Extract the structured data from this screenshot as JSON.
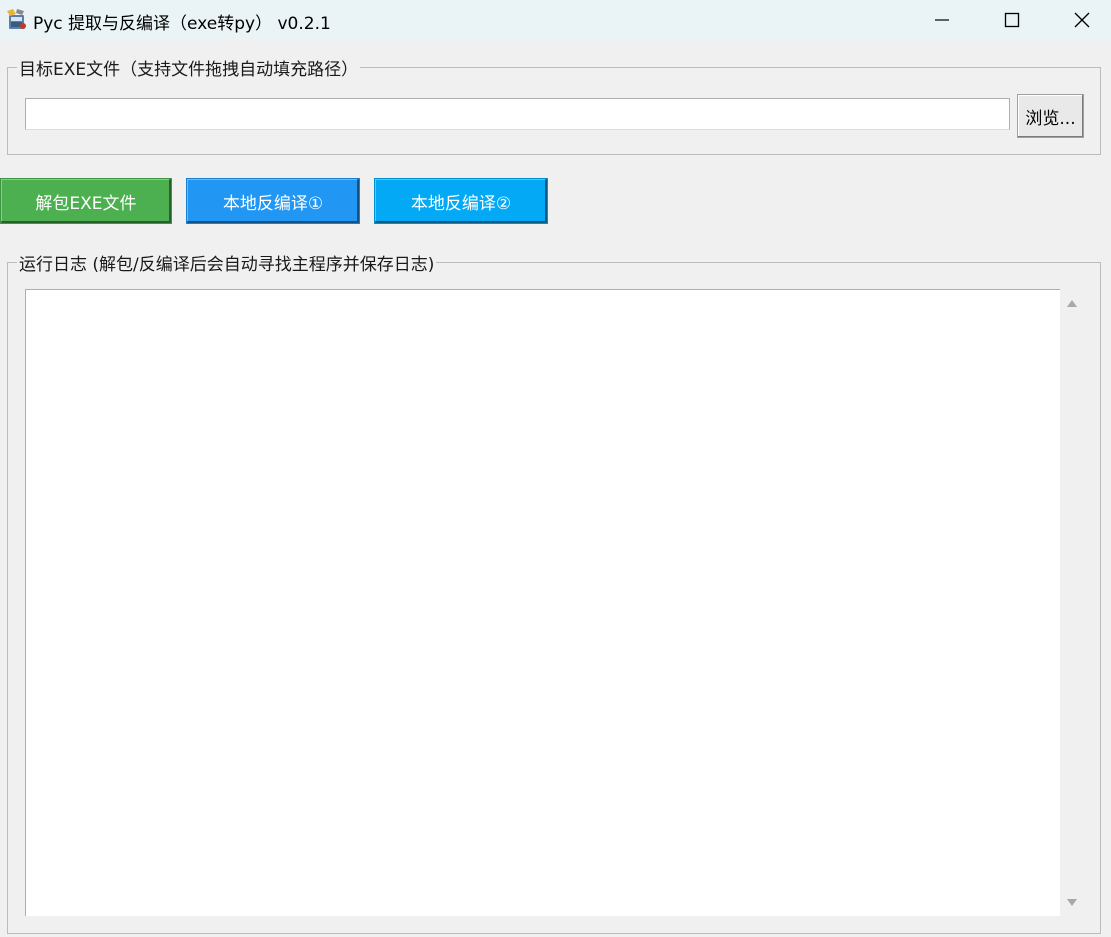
{
  "window": {
    "title": "Pyc 提取与反编译（exe转py） v0.2.1"
  },
  "target_group": {
    "legend": "目标EXE文件（支持文件拖拽自动填充路径）",
    "path_value": "",
    "browse_label": "浏览..."
  },
  "actions": {
    "unpack_label": "解包EXE文件",
    "decompile1_label": "本地反编译①",
    "decompile2_label": "本地反编译②"
  },
  "log_group": {
    "legend": "运行日志 (解包/反编译后会自动寻找主程序并保存日志)",
    "content": ""
  },
  "colors": {
    "unpack_button": "#4caf50",
    "decompile1_button": "#2196f3",
    "decompile2_button": "#03a9f4",
    "titlebar": "#eaf3f5"
  }
}
